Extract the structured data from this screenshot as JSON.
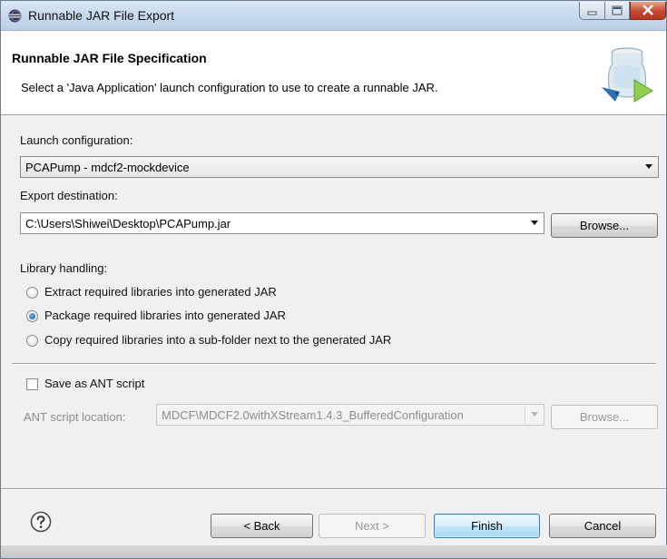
{
  "window": {
    "title": "Runnable JAR File Export",
    "controls": [
      "minimize",
      "maximize",
      "close"
    ]
  },
  "header": {
    "title": "Runnable JAR File Specification",
    "description": "Select a 'Java Application' launch configuration to use to create a runnable JAR.",
    "icon": "jar-export-icon"
  },
  "launch": {
    "label": "Launch configuration:",
    "selected": "PCAPump - mdcf2-mockdevice"
  },
  "export": {
    "label": "Export destination:",
    "value": "C:\\Users\\Shiwei\\Desktop\\PCAPump.jar",
    "browse": "Browse..."
  },
  "library": {
    "label": "Library handling:",
    "options": [
      {
        "label": "Extract required libraries into generated JAR",
        "checked": false
      },
      {
        "label": "Package required libraries into generated JAR",
        "checked": true
      },
      {
        "label": "Copy required libraries into a sub-folder next to the generated JAR",
        "checked": false
      }
    ]
  },
  "ant": {
    "save_label": "Save as ANT script",
    "save_checked": false,
    "location_label": "ANT script location:",
    "location_value": "MDCF\\MDCF2.0withXStream1.4.3_BufferedConfiguration",
    "browse": "Browse..."
  },
  "footer": {
    "help_icon": "help-icon",
    "back": "< Back",
    "next": "Next >",
    "finish": "Finish",
    "cancel": "Cancel"
  },
  "colors": {
    "title_bar": "#c6d8ec",
    "dialog_bg": "#f0f0f0",
    "default_button": "#bee6fd",
    "close_button": "#c6482f"
  }
}
